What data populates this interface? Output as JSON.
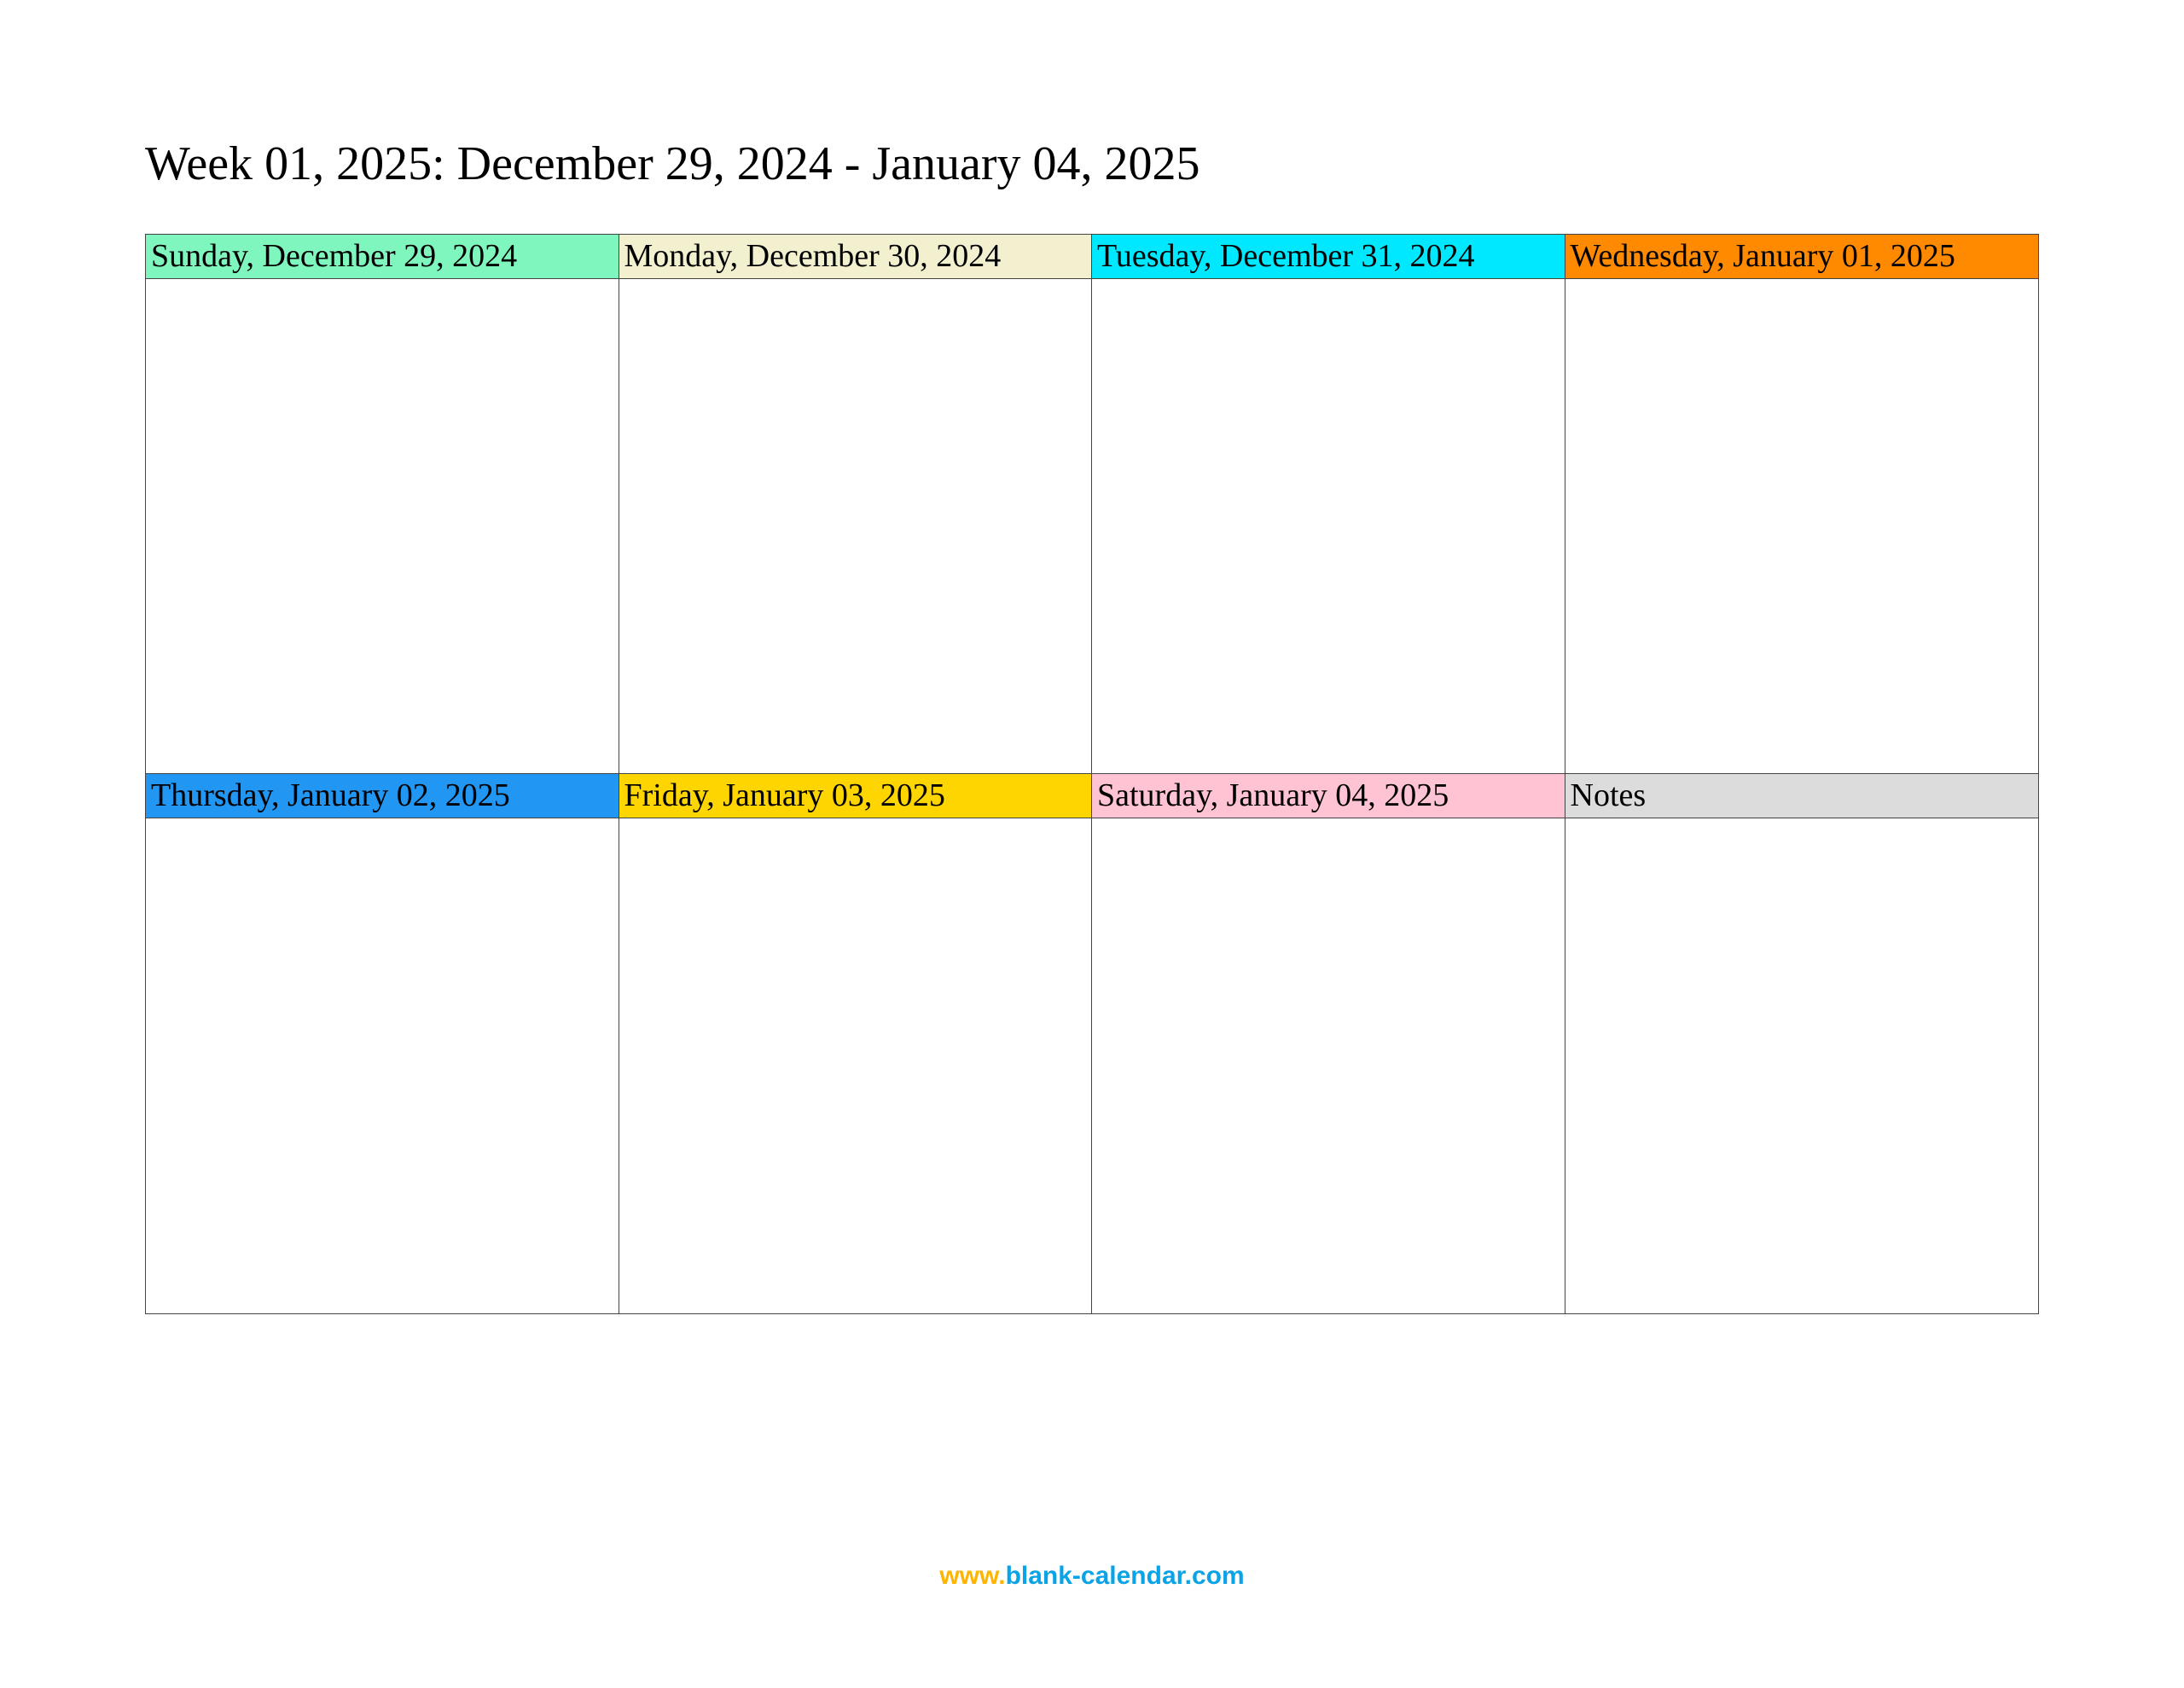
{
  "title": "Week 01, 2025: December 29, 2024 - January 04, 2025",
  "cells": {
    "row1": [
      {
        "label": "Sunday, December 29, 2024",
        "color_class": "hdr-sunday"
      },
      {
        "label": "Monday, December 30, 2024",
        "color_class": "hdr-monday"
      },
      {
        "label": "Tuesday, December 31, 2024",
        "color_class": "hdr-tuesday"
      },
      {
        "label": "Wednesday, January 01, 2025",
        "color_class": "hdr-wednesday"
      }
    ],
    "row2": [
      {
        "label": "Thursday, January 02, 2025",
        "color_class": "hdr-thursday"
      },
      {
        "label": "Friday, January 03, 2025",
        "color_class": "hdr-friday"
      },
      {
        "label": "Saturday, January 04, 2025",
        "color_class": "hdr-saturday"
      },
      {
        "label": "Notes",
        "color_class": "hdr-notes"
      }
    ]
  },
  "footer": {
    "www": "www.",
    "domain": "blank-calendar.com"
  }
}
